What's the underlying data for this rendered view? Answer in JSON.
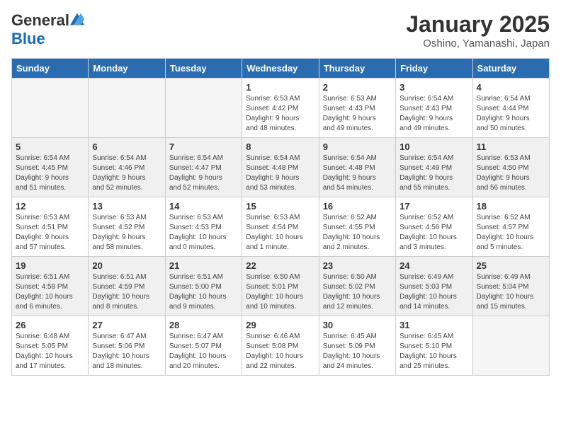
{
  "header": {
    "logo_general": "General",
    "logo_blue": "Blue",
    "month_title": "January 2025",
    "location": "Oshino, Yamanashi, Japan"
  },
  "days_of_week": [
    "Sunday",
    "Monday",
    "Tuesday",
    "Wednesday",
    "Thursday",
    "Friday",
    "Saturday"
  ],
  "weeks": [
    [
      {
        "day": "",
        "info": "",
        "empty": true
      },
      {
        "day": "",
        "info": "",
        "empty": true
      },
      {
        "day": "",
        "info": "",
        "empty": true
      },
      {
        "day": "1",
        "info": "Sunrise: 6:53 AM\nSunset: 4:42 PM\nDaylight: 9 hours\nand 48 minutes."
      },
      {
        "day": "2",
        "info": "Sunrise: 6:53 AM\nSunset: 4:43 PM\nDaylight: 9 hours\nand 49 minutes."
      },
      {
        "day": "3",
        "info": "Sunrise: 6:54 AM\nSunset: 4:43 PM\nDaylight: 9 hours\nand 49 minutes."
      },
      {
        "day": "4",
        "info": "Sunrise: 6:54 AM\nSunset: 4:44 PM\nDaylight: 9 hours\nand 50 minutes."
      }
    ],
    [
      {
        "day": "5",
        "info": "Sunrise: 6:54 AM\nSunset: 4:45 PM\nDaylight: 9 hours\nand 51 minutes."
      },
      {
        "day": "6",
        "info": "Sunrise: 6:54 AM\nSunset: 4:46 PM\nDaylight: 9 hours\nand 52 minutes."
      },
      {
        "day": "7",
        "info": "Sunrise: 6:54 AM\nSunset: 4:47 PM\nDaylight: 9 hours\nand 52 minutes."
      },
      {
        "day": "8",
        "info": "Sunrise: 6:54 AM\nSunset: 4:48 PM\nDaylight: 9 hours\nand 53 minutes."
      },
      {
        "day": "9",
        "info": "Sunrise: 6:54 AM\nSunset: 4:48 PM\nDaylight: 9 hours\nand 54 minutes."
      },
      {
        "day": "10",
        "info": "Sunrise: 6:54 AM\nSunset: 4:49 PM\nDaylight: 9 hours\nand 55 minutes."
      },
      {
        "day": "11",
        "info": "Sunrise: 6:53 AM\nSunset: 4:50 PM\nDaylight: 9 hours\nand 56 minutes."
      }
    ],
    [
      {
        "day": "12",
        "info": "Sunrise: 6:53 AM\nSunset: 4:51 PM\nDaylight: 9 hours\nand 57 minutes."
      },
      {
        "day": "13",
        "info": "Sunrise: 6:53 AM\nSunset: 4:52 PM\nDaylight: 9 hours\nand 58 minutes."
      },
      {
        "day": "14",
        "info": "Sunrise: 6:53 AM\nSunset: 4:53 PM\nDaylight: 10 hours\nand 0 minutes."
      },
      {
        "day": "15",
        "info": "Sunrise: 6:53 AM\nSunset: 4:54 PM\nDaylight: 10 hours\nand 1 minute."
      },
      {
        "day": "16",
        "info": "Sunrise: 6:52 AM\nSunset: 4:55 PM\nDaylight: 10 hours\nand 2 minutes."
      },
      {
        "day": "17",
        "info": "Sunrise: 6:52 AM\nSunset: 4:56 PM\nDaylight: 10 hours\nand 3 minutes."
      },
      {
        "day": "18",
        "info": "Sunrise: 6:52 AM\nSunset: 4:57 PM\nDaylight: 10 hours\nand 5 minutes."
      }
    ],
    [
      {
        "day": "19",
        "info": "Sunrise: 6:51 AM\nSunset: 4:58 PM\nDaylight: 10 hours\nand 6 minutes."
      },
      {
        "day": "20",
        "info": "Sunrise: 6:51 AM\nSunset: 4:59 PM\nDaylight: 10 hours\nand 8 minutes."
      },
      {
        "day": "21",
        "info": "Sunrise: 6:51 AM\nSunset: 5:00 PM\nDaylight: 10 hours\nand 9 minutes."
      },
      {
        "day": "22",
        "info": "Sunrise: 6:50 AM\nSunset: 5:01 PM\nDaylight: 10 hours\nand 10 minutes."
      },
      {
        "day": "23",
        "info": "Sunrise: 6:50 AM\nSunset: 5:02 PM\nDaylight: 10 hours\nand 12 minutes."
      },
      {
        "day": "24",
        "info": "Sunrise: 6:49 AM\nSunset: 5:03 PM\nDaylight: 10 hours\nand 14 minutes."
      },
      {
        "day": "25",
        "info": "Sunrise: 6:49 AM\nSunset: 5:04 PM\nDaylight: 10 hours\nand 15 minutes."
      }
    ],
    [
      {
        "day": "26",
        "info": "Sunrise: 6:48 AM\nSunset: 5:05 PM\nDaylight: 10 hours\nand 17 minutes."
      },
      {
        "day": "27",
        "info": "Sunrise: 6:47 AM\nSunset: 5:06 PM\nDaylight: 10 hours\nand 18 minutes."
      },
      {
        "day": "28",
        "info": "Sunrise: 6:47 AM\nSunset: 5:07 PM\nDaylight: 10 hours\nand 20 minutes."
      },
      {
        "day": "29",
        "info": "Sunrise: 6:46 AM\nSunset: 5:08 PM\nDaylight: 10 hours\nand 22 minutes."
      },
      {
        "day": "30",
        "info": "Sunrise: 6:45 AM\nSunset: 5:09 PM\nDaylight: 10 hours\nand 24 minutes."
      },
      {
        "day": "31",
        "info": "Sunrise: 6:45 AM\nSunset: 5:10 PM\nDaylight: 10 hours\nand 25 minutes."
      },
      {
        "day": "",
        "info": "",
        "empty": true
      }
    ]
  ]
}
